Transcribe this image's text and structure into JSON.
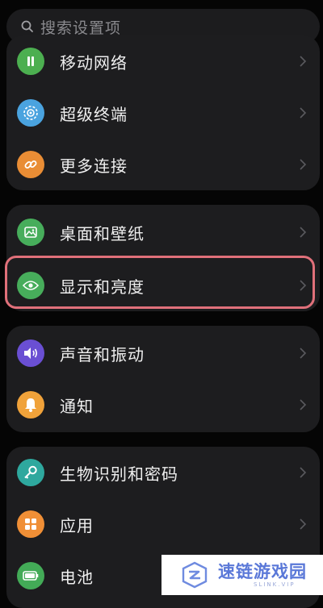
{
  "search": {
    "placeholder": "搜索设置项",
    "icon": "search-icon"
  },
  "groups": [
    {
      "items": [
        {
          "label": "移动网络",
          "icon": "mobile-network-icon",
          "color": "#4caf50"
        },
        {
          "label": "超级终端",
          "icon": "super-device-icon",
          "color": "#4aa3df"
        },
        {
          "label": "更多连接",
          "icon": "link-icon",
          "color": "#e98d35"
        }
      ]
    },
    {
      "items": [
        {
          "label": "桌面和壁纸",
          "icon": "wallpaper-icon",
          "color": "#47ad5b"
        },
        {
          "label": "显示和亮度",
          "icon": "eye-icon",
          "color": "#47ad5b",
          "highlighted": true
        }
      ]
    },
    {
      "items": [
        {
          "label": "声音和振动",
          "icon": "volume-icon",
          "color": "#6a4fd3"
        },
        {
          "label": "通知",
          "icon": "bell-icon",
          "color": "#f0a23a"
        }
      ]
    },
    {
      "items": [
        {
          "label": "生物识别和密码",
          "icon": "key-icon",
          "color": "#2ea89e"
        },
        {
          "label": "应用",
          "icon": "apps-grid-icon",
          "color": "#f08f36"
        },
        {
          "label": "电池",
          "icon": "battery-icon",
          "color": "#43ab57"
        }
      ]
    }
  ],
  "highlight_color": "#e0707a",
  "watermark": {
    "text": "速链游戏园",
    "sub": "SLINK.VIP"
  }
}
